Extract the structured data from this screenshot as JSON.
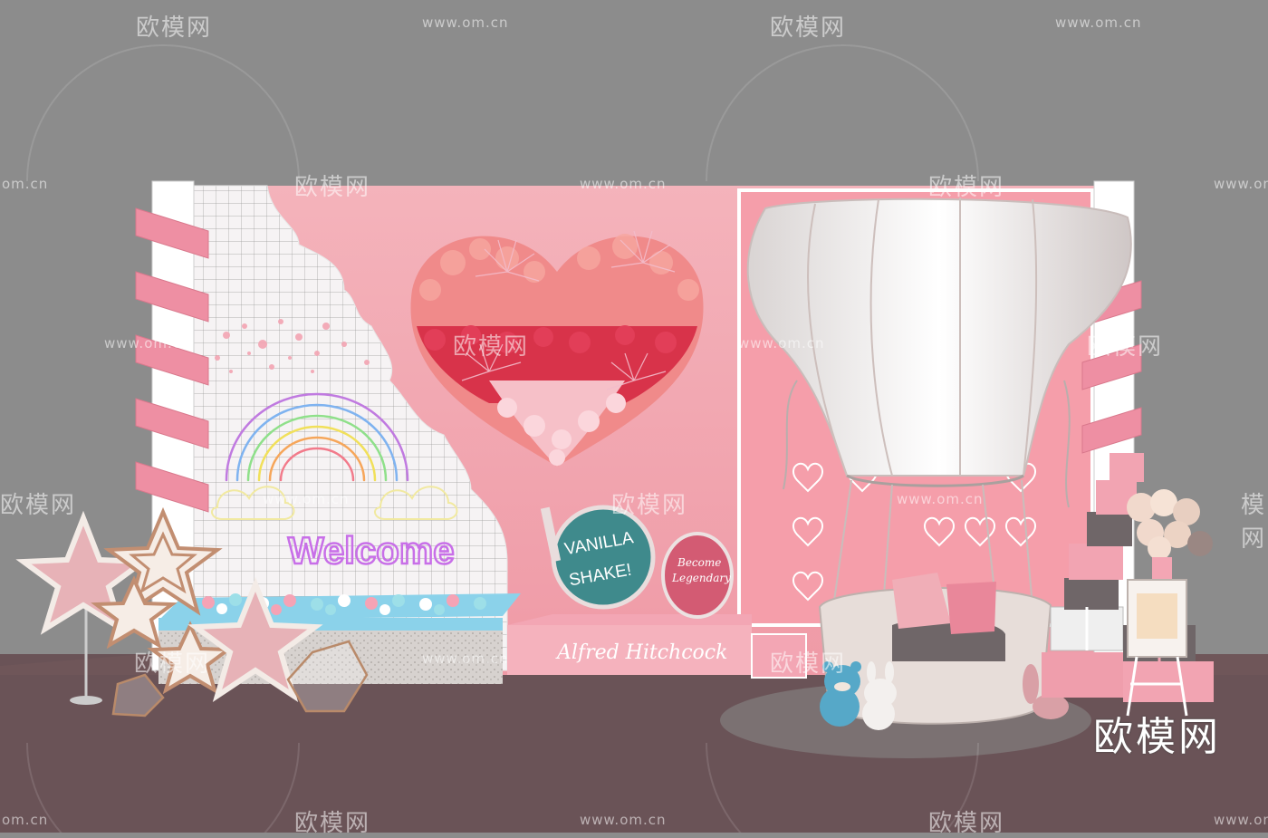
{
  "watermark": {
    "brand": "欧模网",
    "url": "www.om.cn",
    "url_short": "om.cn",
    "partial": "模网"
  },
  "signs": {
    "welcome": "Welcome",
    "vanilla": "VANILLA",
    "shake": "SHAKE!",
    "become": "Become",
    "legendary": "Legendary",
    "platform": "Alfred Hitchcock"
  },
  "colors": {
    "background": "#8c8c8c",
    "floor": "#6a5357",
    "backdrop_pink": "#f2aeb6",
    "accent_red": "#d8334a",
    "teal_sign": "#3f8a8c"
  }
}
